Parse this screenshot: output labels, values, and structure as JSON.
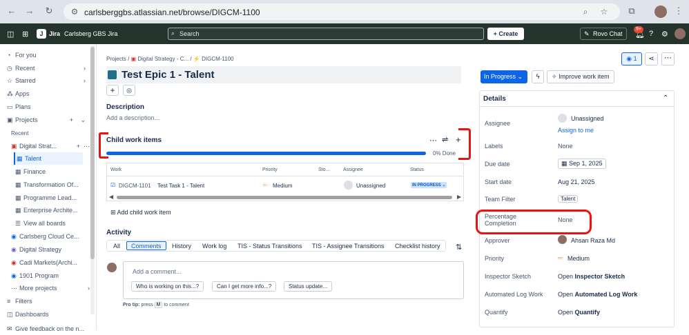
{
  "browser": {
    "url": "carlsberggbs.atlassian.net/browse/DIGCM-1100"
  },
  "topbar": {
    "app_name": "Jira",
    "site_name": "Carlsberg GBS Jira",
    "search_placeholder": "Search",
    "create_label": "Create",
    "rovo_label": "Rovo Chat",
    "notif_badge": "9+"
  },
  "sidebar": {
    "items": [
      {
        "label": "For you",
        "icon": "clock-icon"
      },
      {
        "label": "Recent",
        "icon": "clock-icon"
      },
      {
        "label": "Starred",
        "icon": "star-icon"
      },
      {
        "label": "Apps",
        "icon": "apps-icon"
      },
      {
        "label": "Plans",
        "icon": "plans-icon"
      },
      {
        "label": "Projects",
        "icon": "projects-icon"
      }
    ],
    "recent_header": "Recent",
    "project": "Digital Strat...",
    "boards": [
      "Talent",
      "Finance",
      "Transformation Of...",
      "Programme Lead...",
      "Enterprise Archite...",
      "View all boards"
    ],
    "other_projects": [
      "Carlsberg Cloud Ce...",
      "Digital Strategy",
      "Cadi Markets(Archi...",
      "1901 Program",
      "More projects"
    ],
    "bottom": [
      "Filters",
      "Dashboards",
      "Give feedback on the n..."
    ]
  },
  "breadcrumb": {
    "root": "Projects",
    "project": "Digital Strategy - C...",
    "issue": "DIGCM-1100"
  },
  "issue": {
    "title": "Test Epic 1 - Talent",
    "description_label": "Description",
    "description_placeholder": "Add a description...",
    "child_items_label": "Child work items",
    "progress_label": "0% Done",
    "progress_fraction": 0,
    "table": {
      "headers": [
        "Work",
        "Priority",
        "Sto...",
        "Assignee",
        "Status"
      ],
      "rows": [
        {
          "key": "DIGCM-1101",
          "summary": "Test Task 1 - Talent",
          "priority": "Medium",
          "assignee": "Unassigned",
          "status": "IN PROGRESS"
        }
      ]
    },
    "add_child_label": "Add child work item",
    "activity_label": "Activity",
    "activity_tabs": [
      "All",
      "Comments",
      "History",
      "Work log",
      "TIS - Status Transitions",
      "TIS - Assignee Transitions",
      "Checklist history"
    ],
    "comment_placeholder": "Add a comment...",
    "suggestions": [
      "Who is working on this...?",
      "Can I get more info...?",
      "Status update..."
    ],
    "protip": {
      "prefix": "Pro tip:",
      "text": "press",
      "key": "M",
      "suffix": "to comment"
    }
  },
  "right": {
    "watch_count": "1",
    "status_label": "In Progress",
    "improve_label": "Improve work item",
    "details_label": "Details",
    "fields": [
      {
        "label": "Assignee",
        "value": "Unassigned",
        "link": "Assign to me"
      },
      {
        "label": "Labels",
        "value": "None"
      },
      {
        "label": "Due date",
        "value": "Sep 1, 2025"
      },
      {
        "label": "Start date",
        "value": "Aug 21, 2025"
      },
      {
        "label": "Team Filter",
        "value": "Talent"
      },
      {
        "label": "Percentage Completion",
        "value": "None"
      },
      {
        "label": "Approver",
        "value": "Ahsan Raza Md"
      },
      {
        "label": "Priority",
        "value": "Medium"
      },
      {
        "label": "Inspector Sketch",
        "value_prefix": "Open",
        "value": "Inspector Sketch"
      },
      {
        "label": "Automated Log Work",
        "value_prefix": "Open",
        "value": "Automated Log Work"
      },
      {
        "label": "Quantify",
        "value_prefix": "Open",
        "value": "Quantify"
      }
    ]
  },
  "colors": {
    "accent": "#0c66e4",
    "topbar": "#24332c",
    "highlight": "#e11111"
  }
}
